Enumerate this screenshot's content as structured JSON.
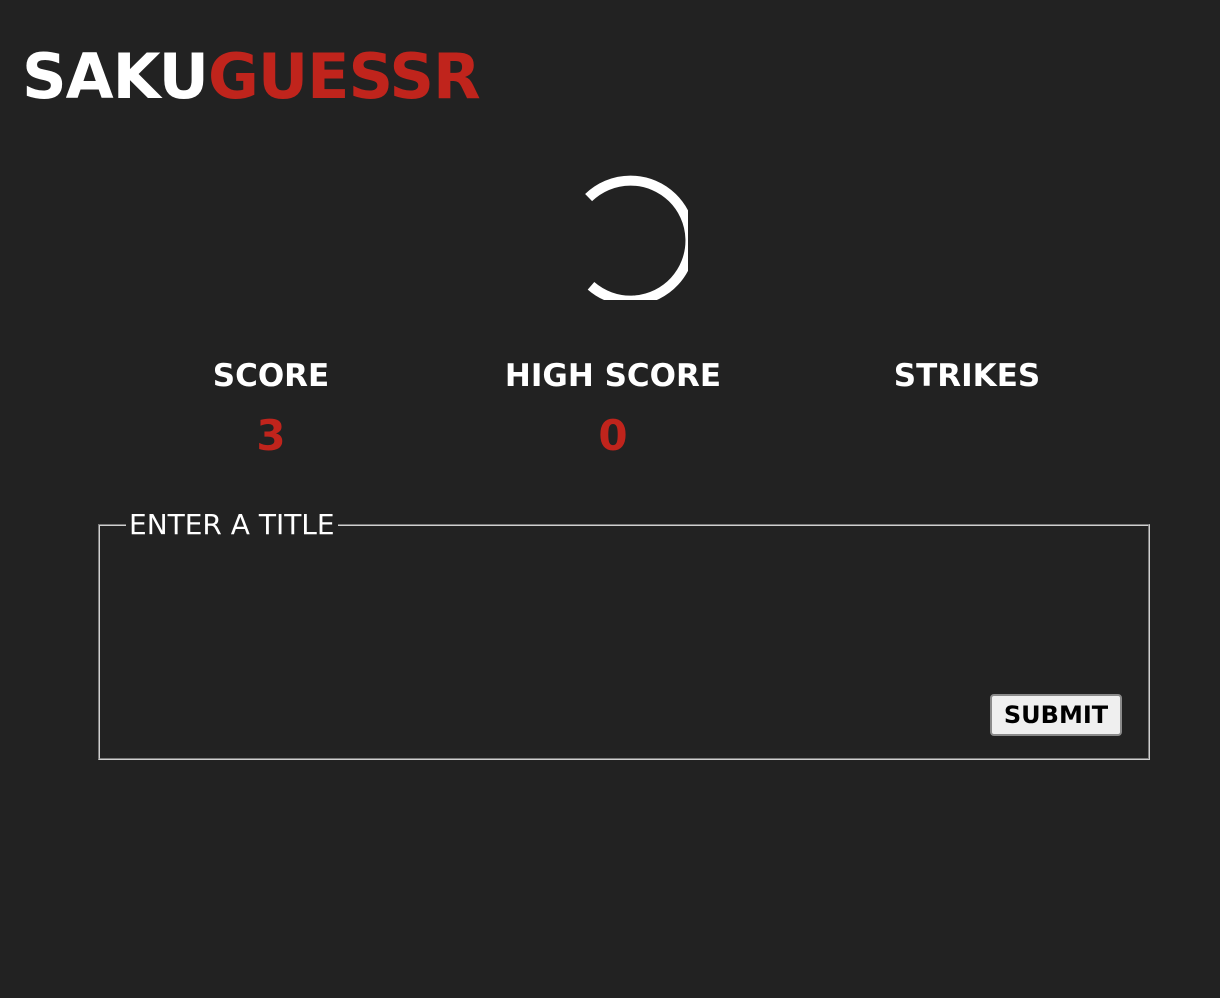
{
  "header": {
    "logo_part_a": "SAKU",
    "logo_part_b": "GUESSR"
  },
  "colors": {
    "background": "#222222",
    "accent": "#c0241c",
    "text": "#ffffff"
  },
  "loader": {
    "icon": "loading-spinner-icon"
  },
  "stats": {
    "score": {
      "label": "SCORE",
      "value": "3"
    },
    "high_score": {
      "label": "HIGH SCORE",
      "value": "0"
    },
    "strikes": {
      "label": "STRIKES",
      "value": ""
    }
  },
  "guess_form": {
    "legend": "ENTER A TITLE",
    "submit_label": "SUBMIT"
  }
}
